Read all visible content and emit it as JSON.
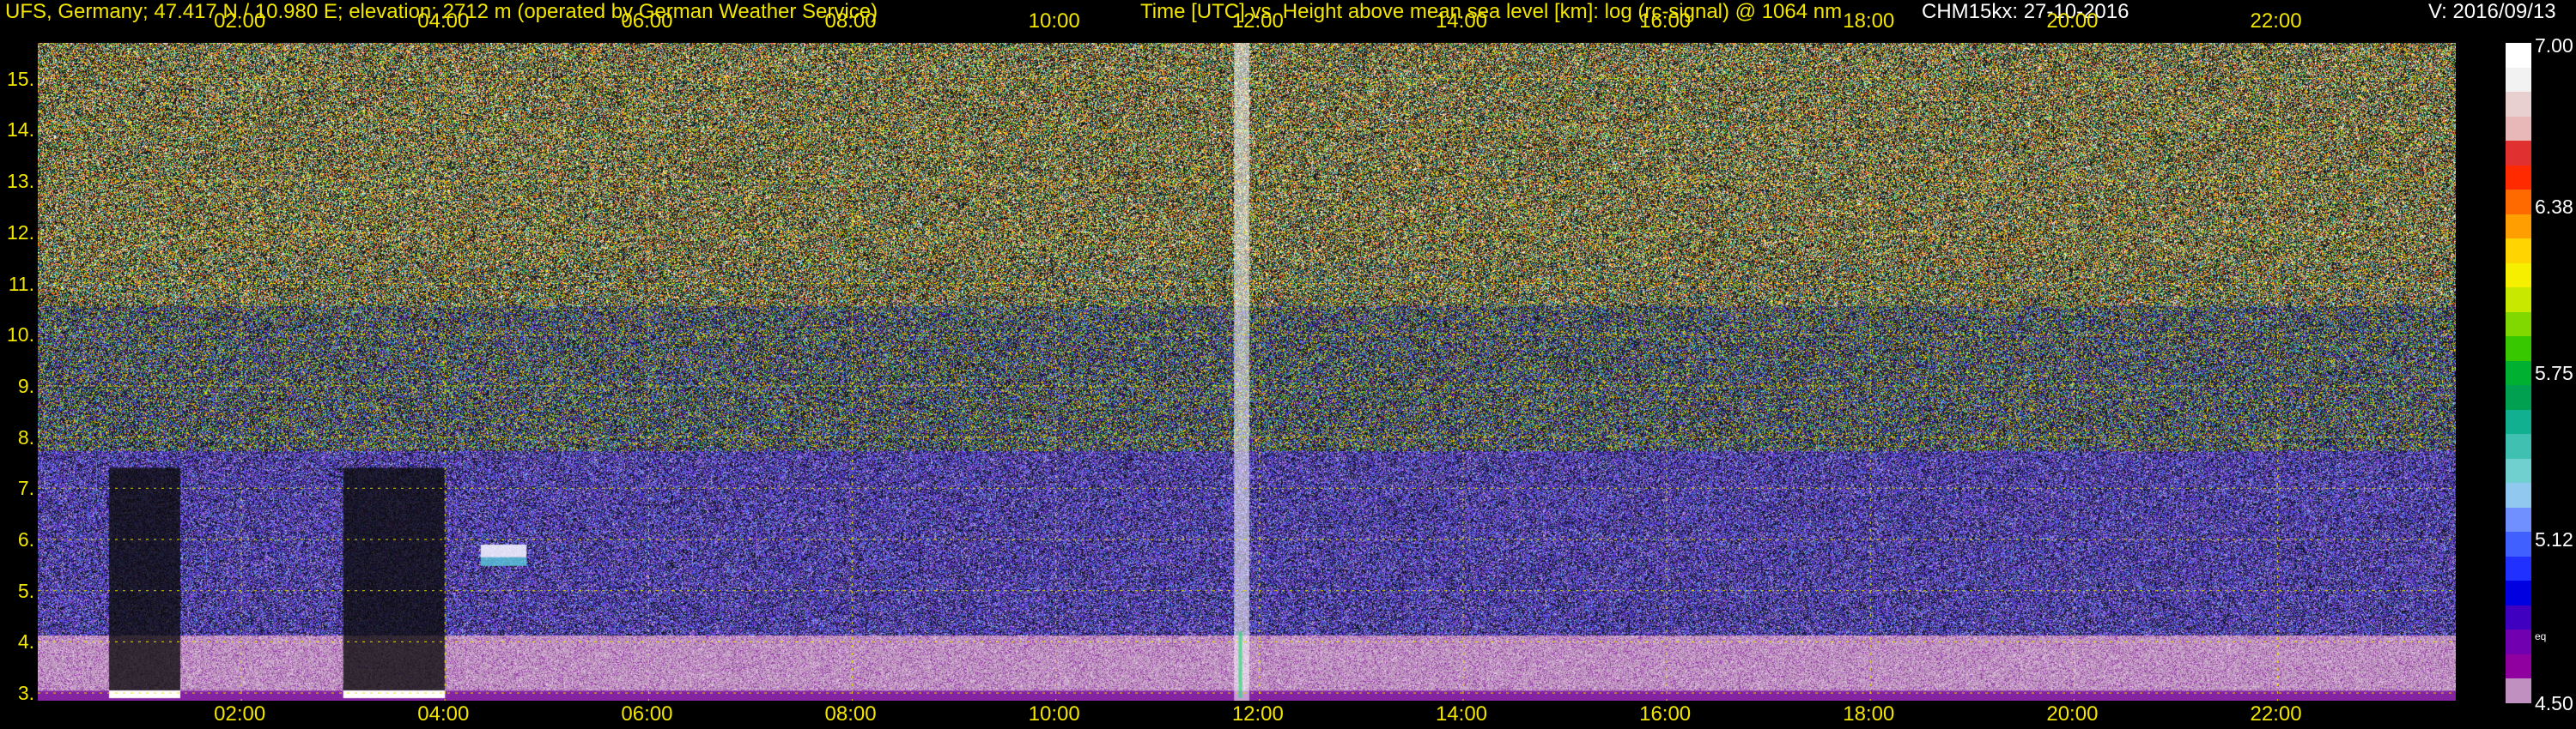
{
  "header": {
    "station": "UFS, Germany; 47.417 N / 10.980 E; elevation: 2712 m  (operated by German Weather Service)",
    "title": "Time [UTC] vs. Height above mean sea level [km]: log (rc-signal) @ 1064 nm",
    "instrument": "CHM15kx: 27-10-2016",
    "version": "V: 2016/09/13"
  },
  "chart_data": {
    "type": "heatmap",
    "title": "Time [UTC] vs. Height above mean sea level [km]: log (rc-signal) @ 1064 nm",
    "xlabel": "Time [UTC]",
    "ylabel": "Height above mean sea level [km]",
    "x_ticks": [
      "02:00",
      "04:00",
      "06:00",
      "08:00",
      "10:00",
      "12:00",
      "14:00",
      "16:00",
      "18:00",
      "20:00",
      "22:00"
    ],
    "x_tick_hours": [
      2,
      4,
      6,
      8,
      10,
      12,
      14,
      16,
      18,
      20,
      22
    ],
    "xlim_hours": [
      0,
      23.75
    ],
    "y_ticks": [
      "3.",
      "4.",
      "5.",
      "6.",
      "7.",
      "8.",
      "9.",
      "10.",
      "11.",
      "12.",
      "13.",
      "14.",
      "15."
    ],
    "y_tick_values": [
      3,
      4,
      5,
      6,
      7,
      8,
      9,
      10,
      11,
      12,
      13,
      14,
      15
    ],
    "ylim_km": [
      2.85,
      15.7
    ],
    "grid": true,
    "colorbar": {
      "label": "eq",
      "range": [
        4.5,
        7.0
      ],
      "tick_labels": [
        "7.00",
        "6.38",
        "5.75",
        "5.12",
        "4.50"
      ],
      "tick_values": [
        7.0,
        6.38,
        5.75,
        5.12,
        4.5
      ],
      "colors": [
        "#ffffff",
        "#f2f2f2",
        "#e8d0d0",
        "#e8b8b8",
        "#e03030",
        "#ff2a00",
        "#ff6a00",
        "#ff9e00",
        "#ffd400",
        "#f6f000",
        "#c8e800",
        "#80d800",
        "#38c800",
        "#00b030",
        "#00a050",
        "#10b090",
        "#40c0b0",
        "#70d0d0",
        "#90c8f0",
        "#7090ff",
        "#4060ff",
        "#2030ff",
        "#0000e0",
        "#4000c0",
        "#7000b0",
        "#9000a0",
        "#c090c0"
      ]
    },
    "features": [
      {
        "name": "aerosol layer near ground",
        "x_hours": [
          0,
          23.75
        ],
        "y_km": [
          2.85,
          3.05
        ]
      },
      {
        "name": "low clouds",
        "x_hours": [
          0.7,
          1.4
        ],
        "y_km": [
          2.9,
          3.05
        ]
      },
      {
        "name": "low clouds",
        "x_hours": [
          3.0,
          4.0
        ],
        "y_km": [
          2.9,
          3.05
        ]
      },
      {
        "name": "cloud",
        "x_hours": [
          4.35,
          4.8
        ],
        "y_km": [
          5.65,
          5.9
        ]
      },
      {
        "name": "precipitation / fog column",
        "x_hours": [
          11.75,
          11.9
        ],
        "y_km": [
          2.85,
          15.7
        ]
      }
    ]
  }
}
